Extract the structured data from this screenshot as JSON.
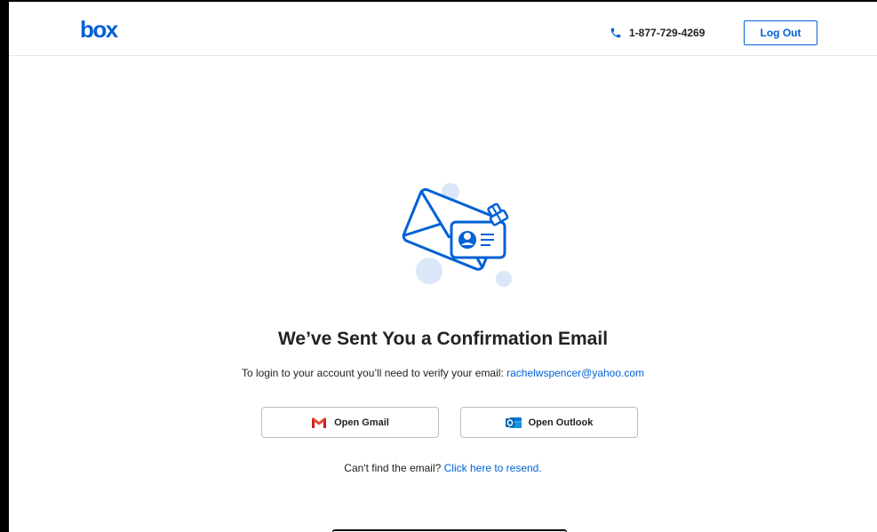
{
  "header": {
    "logo_text": "box",
    "phone": "1-877-729-4269",
    "logout_label": "Log Out"
  },
  "main": {
    "title": "We’ve Sent You a Confirmation Email",
    "subtitle_prefix": "To login to your account you’ll need to verify your email: ",
    "email": "rachelwspencer@yahoo.com",
    "gmail_label": "Open Gmail",
    "outlook_label": "Open Outlook",
    "resend_prefix": "Can't find the email? ",
    "resend_link": "Click here to resend."
  },
  "colors": {
    "accent": "#0061d5",
    "text": "#222222",
    "illustration_light": "#dbe7f8"
  },
  "icons": [
    "phone-icon",
    "gmail-icon",
    "outlook-icon",
    "envelope-illustration"
  ]
}
